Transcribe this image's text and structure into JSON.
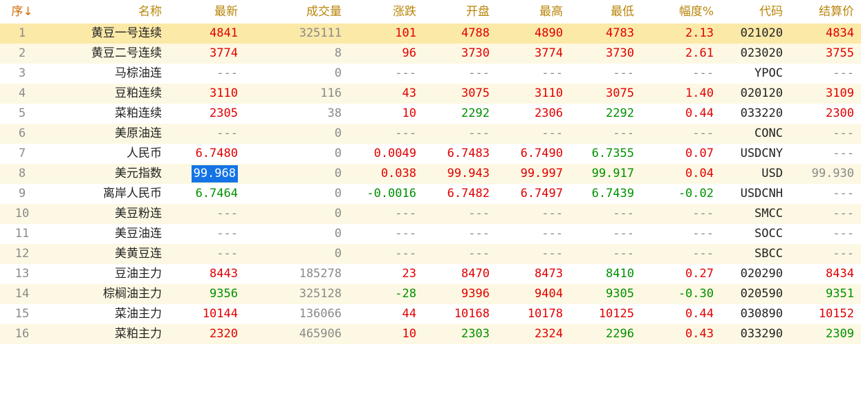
{
  "header": [
    "序↓",
    "名称",
    "最新",
    "成交量",
    "涨跌",
    "开盘",
    "最高",
    "最低",
    "幅度%",
    "代码",
    "结算价"
  ],
  "rows": [
    {
      "cells": [
        "1",
        "黄豆一号连续",
        "4841",
        "325111",
        "101",
        "4788",
        "4890",
        "4783",
        "2.13",
        "021020",
        "4834"
      ],
      "colors": [
        "idx",
        "k",
        "r",
        "gr",
        "r",
        "r",
        "r",
        "r",
        "r",
        "k",
        "r"
      ],
      "selected": true
    },
    {
      "cells": [
        "2",
        "黄豆二号连续",
        "3774",
        "8",
        "96",
        "3730",
        "3774",
        "3730",
        "2.61",
        "023020",
        "3755"
      ],
      "colors": [
        "idx",
        "k",
        "r",
        "gr",
        "r",
        "r",
        "r",
        "r",
        "r",
        "k",
        "r"
      ]
    },
    {
      "cells": [
        "3",
        "马棕油连",
        "---",
        "0",
        "---",
        "---",
        "---",
        "---",
        "---",
        "YPOC",
        "---"
      ],
      "colors": [
        "idx",
        "k",
        "gr",
        "gr",
        "gr",
        "gr",
        "gr",
        "gr",
        "gr",
        "k",
        "gr"
      ]
    },
    {
      "cells": [
        "4",
        "豆粕连续",
        "3110",
        "116",
        "43",
        "3075",
        "3110",
        "3075",
        "1.40",
        "020120",
        "3109"
      ],
      "colors": [
        "idx",
        "k",
        "r",
        "gr",
        "r",
        "r",
        "r",
        "r",
        "r",
        "k",
        "r"
      ]
    },
    {
      "cells": [
        "5",
        "菜粕连续",
        "2305",
        "38",
        "10",
        "2292",
        "2306",
        "2292",
        "0.44",
        "033220",
        "2300"
      ],
      "colors": [
        "idx",
        "k",
        "r",
        "gr",
        "r",
        "g",
        "r",
        "g",
        "r",
        "k",
        "r"
      ]
    },
    {
      "cells": [
        "6",
        "美原油连",
        "---",
        "0",
        "---",
        "---",
        "---",
        "---",
        "---",
        "CONC",
        "---"
      ],
      "colors": [
        "idx",
        "k",
        "gr",
        "gr",
        "gr",
        "gr",
        "gr",
        "gr",
        "gr",
        "k",
        "gr"
      ]
    },
    {
      "cells": [
        "7",
        "人民币",
        "6.7480",
        "0",
        "0.0049",
        "6.7483",
        "6.7490",
        "6.7355",
        "0.07",
        "USDCNY",
        "---"
      ],
      "colors": [
        "idx",
        "k",
        "r",
        "gr",
        "r",
        "r",
        "r",
        "g",
        "r",
        "k",
        "gr"
      ]
    },
    {
      "cells": [
        "8",
        "美元指数",
        "99.968",
        "0",
        "0.038",
        "99.943",
        "99.997",
        "99.917",
        "0.04",
        "USD",
        "99.930"
      ],
      "colors": [
        "idx",
        "k",
        "hl",
        "gr",
        "r",
        "r",
        "r",
        "g",
        "r",
        "k",
        "gr"
      ]
    },
    {
      "cells": [
        "9",
        "离岸人民币",
        "6.7464",
        "0",
        "-0.0016",
        "6.7482",
        "6.7497",
        "6.7439",
        "-0.02",
        "USDCNH",
        "---"
      ],
      "colors": [
        "idx",
        "k",
        "g",
        "gr",
        "g",
        "r",
        "r",
        "g",
        "g",
        "k",
        "gr"
      ]
    },
    {
      "cells": [
        "10",
        "美豆粉连",
        "---",
        "0",
        "---",
        "---",
        "---",
        "---",
        "---",
        "SMCC",
        "---"
      ],
      "colors": [
        "idx",
        "k",
        "gr",
        "gr",
        "gr",
        "gr",
        "gr",
        "gr",
        "gr",
        "k",
        "gr"
      ]
    },
    {
      "cells": [
        "11",
        "美豆油连",
        "---",
        "0",
        "---",
        "---",
        "---",
        "---",
        "---",
        "SOCC",
        "---"
      ],
      "colors": [
        "idx",
        "k",
        "gr",
        "gr",
        "gr",
        "gr",
        "gr",
        "gr",
        "gr",
        "k",
        "gr"
      ]
    },
    {
      "cells": [
        "12",
        "美黄豆连",
        "---",
        "0",
        "---",
        "---",
        "---",
        "---",
        "---",
        "SBCC",
        "---"
      ],
      "colors": [
        "idx",
        "k",
        "gr",
        "gr",
        "gr",
        "gr",
        "gr",
        "gr",
        "gr",
        "k",
        "gr"
      ]
    },
    {
      "cells": [
        "13",
        "豆油主力",
        "8443",
        "185278",
        "23",
        "8470",
        "8473",
        "8410",
        "0.27",
        "020290",
        "8434"
      ],
      "colors": [
        "idx",
        "k",
        "r",
        "gr",
        "r",
        "r",
        "r",
        "g",
        "r",
        "k",
        "r"
      ]
    },
    {
      "cells": [
        "14",
        "棕榈油主力",
        "9356",
        "325128",
        "-28",
        "9396",
        "9404",
        "9305",
        "-0.30",
        "020590",
        "9351"
      ],
      "colors": [
        "idx",
        "k",
        "g",
        "gr",
        "g",
        "r",
        "r",
        "g",
        "g",
        "k",
        "g"
      ]
    },
    {
      "cells": [
        "15",
        "菜油主力",
        "10144",
        "136066",
        "44",
        "10168",
        "10178",
        "10125",
        "0.44",
        "030890",
        "10152"
      ],
      "colors": [
        "idx",
        "k",
        "r",
        "gr",
        "r",
        "r",
        "r",
        "r",
        "r",
        "k",
        "r"
      ]
    },
    {
      "cells": [
        "16",
        "菜粕主力",
        "2320",
        "465906",
        "10",
        "2303",
        "2324",
        "2296",
        "0.43",
        "033290",
        "2309"
      ],
      "colors": [
        "idx",
        "k",
        "r",
        "gr",
        "r",
        "g",
        "r",
        "g",
        "r",
        "k",
        "g"
      ]
    }
  ]
}
